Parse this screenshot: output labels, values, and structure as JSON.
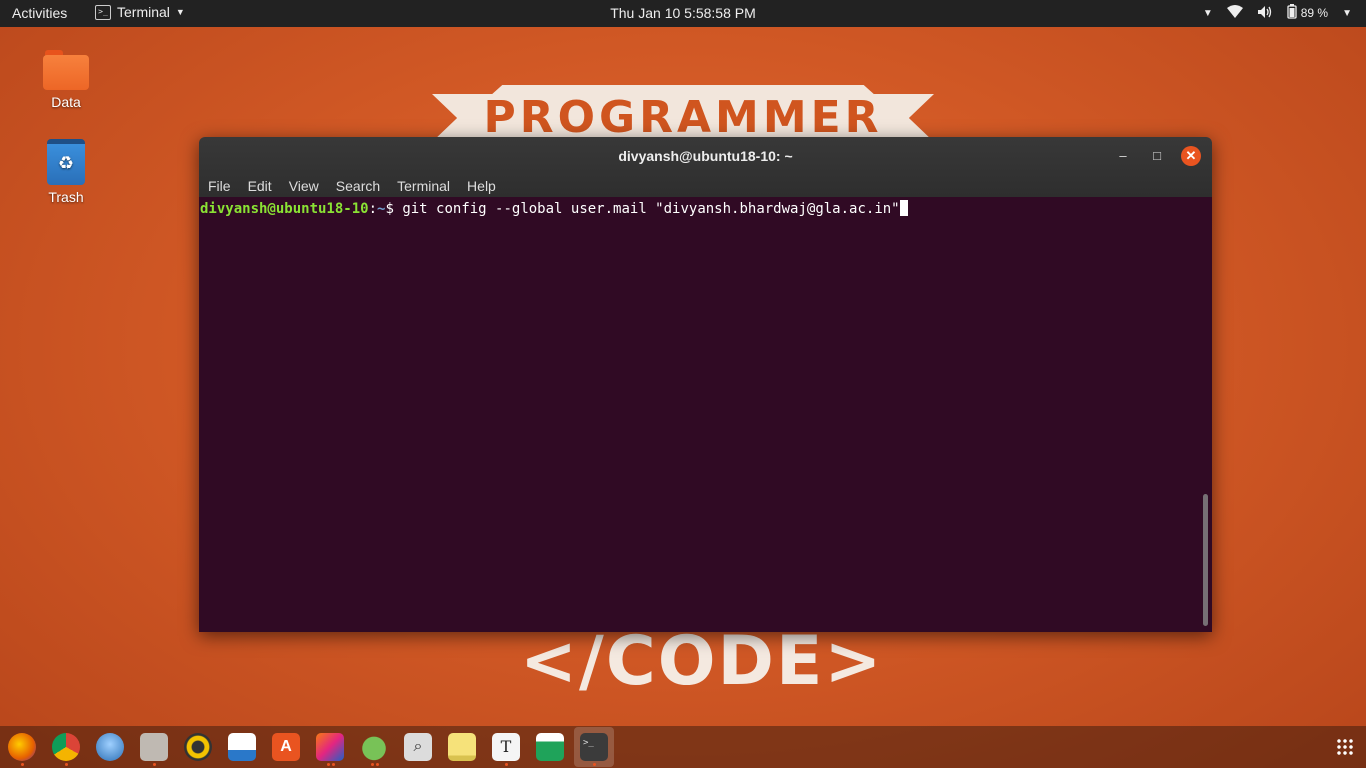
{
  "topbar": {
    "activities": "Activities",
    "app_name": "Terminal",
    "clock": "Thu Jan 10   5:58:58 PM",
    "battery": "89 %"
  },
  "wallpaper": {
    "top_word": "PROGRAMMER",
    "bottom_word": "</CODE>"
  },
  "desktop": {
    "icons": [
      {
        "label": "Data",
        "icon": "folder-icon"
      },
      {
        "label": "Trash",
        "icon": "trash-icon"
      }
    ]
  },
  "window": {
    "title": "divyansh@ubuntu18-10: ~",
    "menu": [
      "File",
      "Edit",
      "View",
      "Search",
      "Terminal",
      "Help"
    ],
    "prompt_user": "divyansh@ubuntu18-10",
    "prompt_sep": ":",
    "prompt_path": "~",
    "prompt_symbol": "$ ",
    "command": "git config --global user.mail \"divyansh.bhardwaj@gla.ac.in\""
  },
  "dock": {
    "apps": [
      "firefox-icon",
      "chrome-icon",
      "thunderbird-icon",
      "files-icon",
      "rhythmbox-icon",
      "writer-icon",
      "software-icon",
      "intellij-icon",
      "android-studio-icon",
      "search-icon",
      "notes-icon",
      "typora-icon",
      "calc-icon",
      "terminal-icon"
    ],
    "colors": {
      "firefox": "#e66000",
      "chrome": "#4285f4",
      "thunderbird": "#2b6fb5",
      "files": "#bfb9b2",
      "rhythmbox": "#f3c200",
      "writer": "#2a78c9",
      "software": "#e95420",
      "intellij": "#1f62c6",
      "android": "#78c257",
      "search": "#dcdcdc",
      "notes": "#f6e27a",
      "typora": "#f5f5f5",
      "calc": "#1fa35a",
      "terminal": "#3b3b3b"
    }
  }
}
